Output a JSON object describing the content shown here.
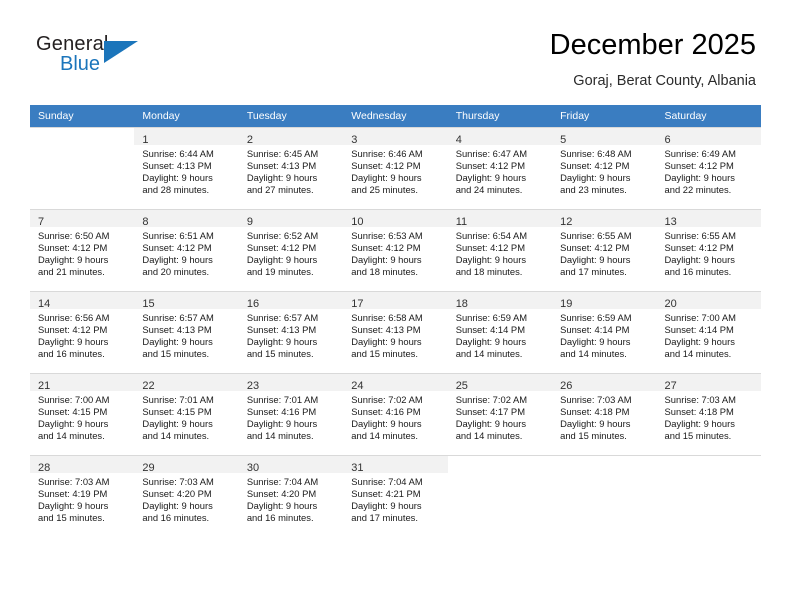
{
  "brand": {
    "name_part1": "General",
    "name_part2": "Blue",
    "accent_color": "#1b75bb"
  },
  "header": {
    "title": "December 2025",
    "subtitle": "Goraj, Berat County, Albania",
    "header_bg": "#3a7dc1"
  },
  "weekday_headers": [
    "Sunday",
    "Monday",
    "Tuesday",
    "Wednesday",
    "Thursday",
    "Friday",
    "Saturday"
  ],
  "weeks": [
    [
      {
        "day": "",
        "lines": [
          "",
          "",
          "",
          ""
        ]
      },
      {
        "day": "1",
        "lines": [
          "Sunrise: 6:44 AM",
          "Sunset: 4:13 PM",
          "Daylight: 9 hours",
          "and 28 minutes."
        ]
      },
      {
        "day": "2",
        "lines": [
          "Sunrise: 6:45 AM",
          "Sunset: 4:13 PM",
          "Daylight: 9 hours",
          "and 27 minutes."
        ]
      },
      {
        "day": "3",
        "lines": [
          "Sunrise: 6:46 AM",
          "Sunset: 4:12 PM",
          "Daylight: 9 hours",
          "and 25 minutes."
        ]
      },
      {
        "day": "4",
        "lines": [
          "Sunrise: 6:47 AM",
          "Sunset: 4:12 PM",
          "Daylight: 9 hours",
          "and 24 minutes."
        ]
      },
      {
        "day": "5",
        "lines": [
          "Sunrise: 6:48 AM",
          "Sunset: 4:12 PM",
          "Daylight: 9 hours",
          "and 23 minutes."
        ]
      },
      {
        "day": "6",
        "lines": [
          "Sunrise: 6:49 AM",
          "Sunset: 4:12 PM",
          "Daylight: 9 hours",
          "and 22 minutes."
        ]
      }
    ],
    [
      {
        "day": "7",
        "lines": [
          "Sunrise: 6:50 AM",
          "Sunset: 4:12 PM",
          "Daylight: 9 hours",
          "and 21 minutes."
        ]
      },
      {
        "day": "8",
        "lines": [
          "Sunrise: 6:51 AM",
          "Sunset: 4:12 PM",
          "Daylight: 9 hours",
          "and 20 minutes."
        ]
      },
      {
        "day": "9",
        "lines": [
          "Sunrise: 6:52 AM",
          "Sunset: 4:12 PM",
          "Daylight: 9 hours",
          "and 19 minutes."
        ]
      },
      {
        "day": "10",
        "lines": [
          "Sunrise: 6:53 AM",
          "Sunset: 4:12 PM",
          "Daylight: 9 hours",
          "and 18 minutes."
        ]
      },
      {
        "day": "11",
        "lines": [
          "Sunrise: 6:54 AM",
          "Sunset: 4:12 PM",
          "Daylight: 9 hours",
          "and 18 minutes."
        ]
      },
      {
        "day": "12",
        "lines": [
          "Sunrise: 6:55 AM",
          "Sunset: 4:12 PM",
          "Daylight: 9 hours",
          "and 17 minutes."
        ]
      },
      {
        "day": "13",
        "lines": [
          "Sunrise: 6:55 AM",
          "Sunset: 4:12 PM",
          "Daylight: 9 hours",
          "and 16 minutes."
        ]
      }
    ],
    [
      {
        "day": "14",
        "lines": [
          "Sunrise: 6:56 AM",
          "Sunset: 4:12 PM",
          "Daylight: 9 hours",
          "and 16 minutes."
        ]
      },
      {
        "day": "15",
        "lines": [
          "Sunrise: 6:57 AM",
          "Sunset: 4:13 PM",
          "Daylight: 9 hours",
          "and 15 minutes."
        ]
      },
      {
        "day": "16",
        "lines": [
          "Sunrise: 6:57 AM",
          "Sunset: 4:13 PM",
          "Daylight: 9 hours",
          "and 15 minutes."
        ]
      },
      {
        "day": "17",
        "lines": [
          "Sunrise: 6:58 AM",
          "Sunset: 4:13 PM",
          "Daylight: 9 hours",
          "and 15 minutes."
        ]
      },
      {
        "day": "18",
        "lines": [
          "Sunrise: 6:59 AM",
          "Sunset: 4:14 PM",
          "Daylight: 9 hours",
          "and 14 minutes."
        ]
      },
      {
        "day": "19",
        "lines": [
          "Sunrise: 6:59 AM",
          "Sunset: 4:14 PM",
          "Daylight: 9 hours",
          "and 14 minutes."
        ]
      },
      {
        "day": "20",
        "lines": [
          "Sunrise: 7:00 AM",
          "Sunset: 4:14 PM",
          "Daylight: 9 hours",
          "and 14 minutes."
        ]
      }
    ],
    [
      {
        "day": "21",
        "lines": [
          "Sunrise: 7:00 AM",
          "Sunset: 4:15 PM",
          "Daylight: 9 hours",
          "and 14 minutes."
        ]
      },
      {
        "day": "22",
        "lines": [
          "Sunrise: 7:01 AM",
          "Sunset: 4:15 PM",
          "Daylight: 9 hours",
          "and 14 minutes."
        ]
      },
      {
        "day": "23",
        "lines": [
          "Sunrise: 7:01 AM",
          "Sunset: 4:16 PM",
          "Daylight: 9 hours",
          "and 14 minutes."
        ]
      },
      {
        "day": "24",
        "lines": [
          "Sunrise: 7:02 AM",
          "Sunset: 4:16 PM",
          "Daylight: 9 hours",
          "and 14 minutes."
        ]
      },
      {
        "day": "25",
        "lines": [
          "Sunrise: 7:02 AM",
          "Sunset: 4:17 PM",
          "Daylight: 9 hours",
          "and 14 minutes."
        ]
      },
      {
        "day": "26",
        "lines": [
          "Sunrise: 7:03 AM",
          "Sunset: 4:18 PM",
          "Daylight: 9 hours",
          "and 15 minutes."
        ]
      },
      {
        "day": "27",
        "lines": [
          "Sunrise: 7:03 AM",
          "Sunset: 4:18 PM",
          "Daylight: 9 hours",
          "and 15 minutes."
        ]
      }
    ],
    [
      {
        "day": "28",
        "lines": [
          "Sunrise: 7:03 AM",
          "Sunset: 4:19 PM",
          "Daylight: 9 hours",
          "and 15 minutes."
        ]
      },
      {
        "day": "29",
        "lines": [
          "Sunrise: 7:03 AM",
          "Sunset: 4:20 PM",
          "Daylight: 9 hours",
          "and 16 minutes."
        ]
      },
      {
        "day": "30",
        "lines": [
          "Sunrise: 7:04 AM",
          "Sunset: 4:20 PM",
          "Daylight: 9 hours",
          "and 16 minutes."
        ]
      },
      {
        "day": "31",
        "lines": [
          "Sunrise: 7:04 AM",
          "Sunset: 4:21 PM",
          "Daylight: 9 hours",
          "and 17 minutes."
        ]
      },
      {
        "day": "",
        "lines": [
          "",
          "",
          "",
          ""
        ]
      },
      {
        "day": "",
        "lines": [
          "",
          "",
          "",
          ""
        ]
      },
      {
        "day": "",
        "lines": [
          "",
          "",
          "",
          ""
        ]
      }
    ]
  ]
}
